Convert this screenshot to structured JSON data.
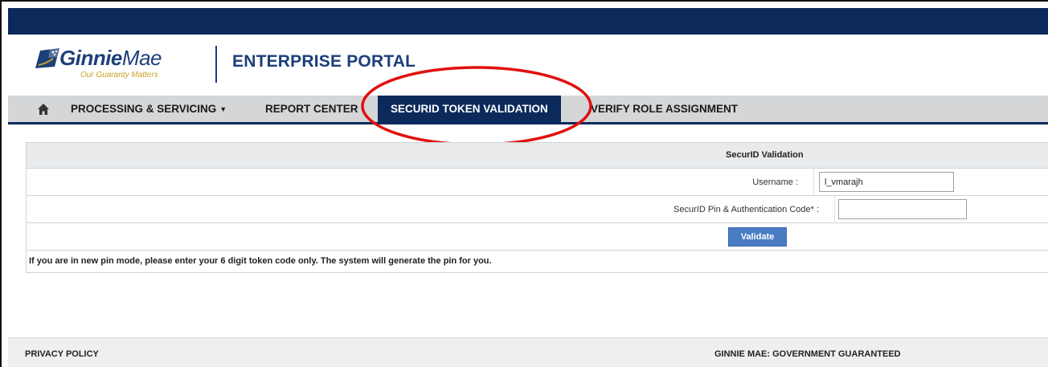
{
  "brand": {
    "name_bold": "Ginnie",
    "name_light": "Mae",
    "tagline": "Our Guaranty Matters",
    "portal_title": "ENTERPRISE PORTAL"
  },
  "nav": {
    "home_icon": "home-icon",
    "items": [
      {
        "label": "PROCESSING & SERVICING",
        "has_dropdown": true
      },
      {
        "label": "REPORT CENTER"
      },
      {
        "label": "SECURID TOKEN VALIDATION",
        "active": true
      },
      {
        "label": "VERIFY ROLE ASSIGNMENT"
      }
    ]
  },
  "form": {
    "title": "SecurID Validation",
    "username_label": "Username",
    "username_value": "l_vmarajh",
    "pin_label": "SecurID Pin & Authentication Code*",
    "pin_value": "",
    "validate_label": "Validate",
    "note": "If you are in new pin mode, please enter your 6 digit token code only. The system will generate the pin for you."
  },
  "footer": {
    "privacy": "PRIVACY POLICY",
    "government": "GINNIE MAE: GOVERNMENT GUARANTEED"
  },
  "colors": {
    "navy": "#0b2a5b",
    "nav_gray": "#d4d6d8",
    "button_blue": "#4a7cc4",
    "annotation_red": "#e01010",
    "tagline_gold": "#c9a227"
  }
}
